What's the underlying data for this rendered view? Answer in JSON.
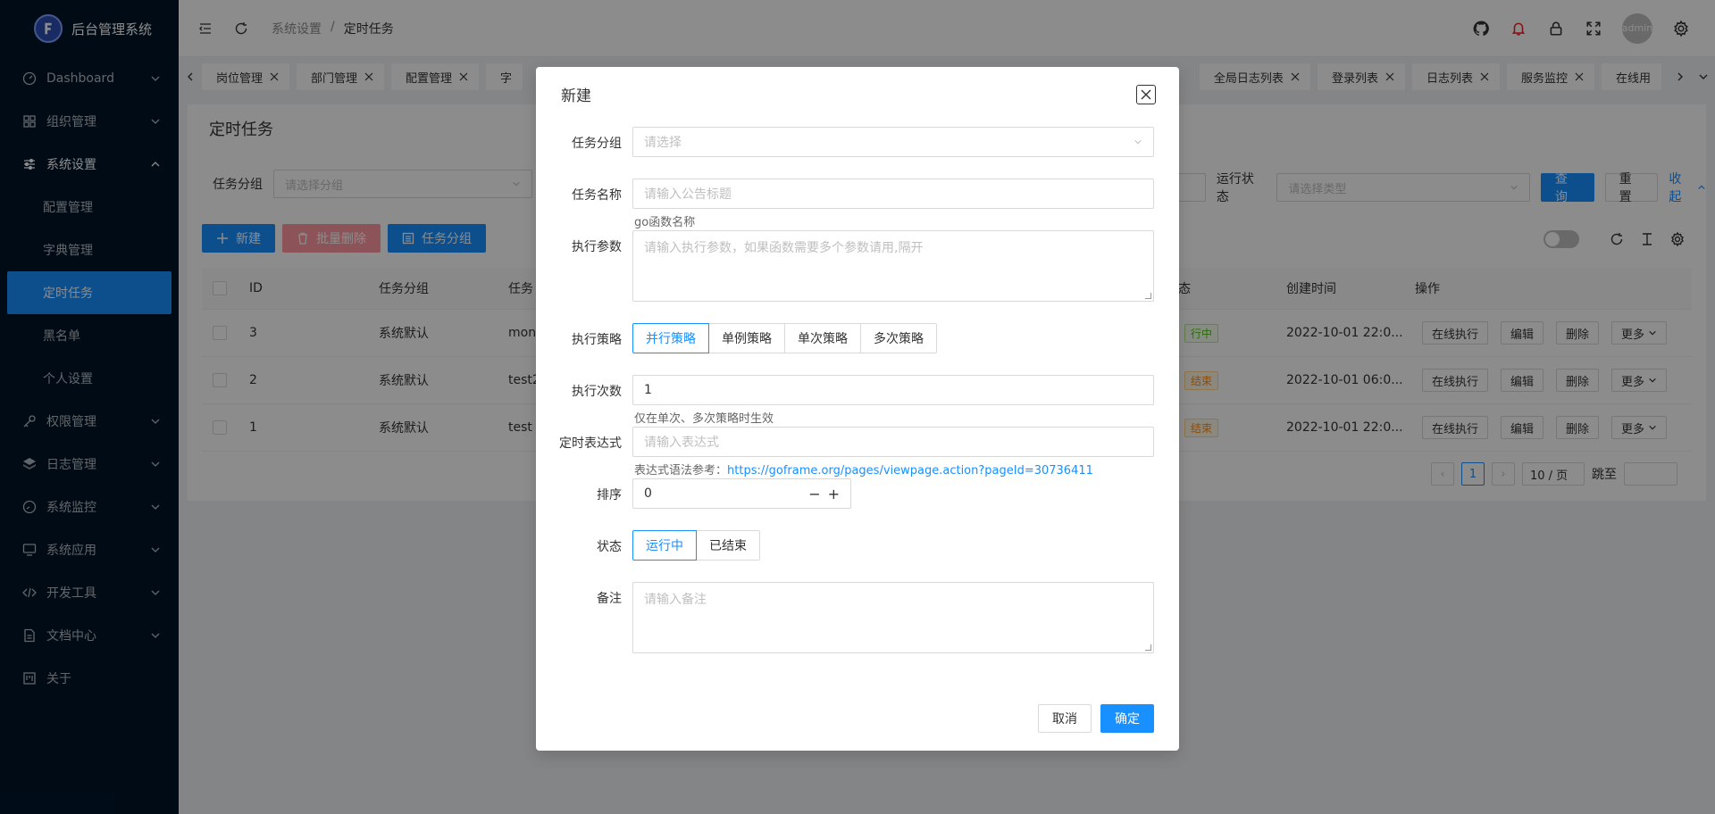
{
  "app": {
    "title": "后台管理系统",
    "avatar_text": "admin"
  },
  "sidebar": {
    "items": [
      {
        "label": "Dashboard",
        "icon": "dashboard-icon"
      },
      {
        "label": "组织管理",
        "icon": "grid-icon"
      },
      {
        "label": "系统设置",
        "icon": "sliders-icon"
      },
      {
        "label": "权限管理",
        "icon": "key-icon"
      },
      {
        "label": "日志管理",
        "icon": "layers-icon"
      },
      {
        "label": "系统监控",
        "icon": "gauge-icon"
      },
      {
        "label": "系统应用",
        "icon": "monitor-icon"
      },
      {
        "label": "开发工具",
        "icon": "code-icon"
      },
      {
        "label": "文档中心",
        "icon": "file-icon"
      },
      {
        "label": "关于",
        "icon": "board-icon"
      }
    ],
    "sub_items": [
      "配置管理",
      "字典管理",
      "定时任务",
      "黑名单",
      "个人设置"
    ]
  },
  "header": {
    "breadcrumb": [
      "系统设置",
      "/",
      "定时任务"
    ]
  },
  "tabs": [
    "岗位管理",
    "部门管理",
    "配置管理",
    "字",
    "全局日志列表",
    "登录列表",
    "日志列表",
    "服务监控",
    "在线用"
  ],
  "page": {
    "title": "定时任务",
    "filter": {
      "group_label": "任务分组",
      "group_placeholder": "请选择分组",
      "status_label": "运行状态",
      "status_placeholder": "请选择类型",
      "query": "查询",
      "reset": "重置",
      "collapse": "收起"
    },
    "toolbar": {
      "new": "新建",
      "batch_delete": "批量删除",
      "group": "任务分组"
    },
    "table": {
      "columns": [
        "ID",
        "任务分组",
        "任务",
        "态",
        "创建时间",
        "操作"
      ],
      "rows": [
        {
          "id": "3",
          "group": "系统默认",
          "name": "moni",
          "status": "行中",
          "created": "2022-10-01 22:0..."
        },
        {
          "id": "2",
          "group": "系统默认",
          "name": "test2",
          "status": "结束",
          "created": "2022-10-01 06:0..."
        },
        {
          "id": "1",
          "group": "系统默认",
          "name": "test",
          "status": "结束",
          "created": "2022-10-01 22:0..."
        }
      ],
      "actions": [
        "在线执行",
        "编辑",
        "删除",
        "更多"
      ]
    },
    "pager": {
      "current": "1",
      "size": "10 / 页",
      "jump": "跳至"
    }
  },
  "modal": {
    "title": "新建",
    "fields": {
      "group": {
        "label": "任务分组",
        "placeholder": "请选择"
      },
      "name": {
        "label": "任务名称",
        "placeholder": "请输入公告标题",
        "hint": "go函数名称"
      },
      "params": {
        "label": "执行参数",
        "placeholder": "请输入执行参数，如果函数需要多个参数请用,隔开"
      },
      "policy": {
        "label": "执行策略",
        "options": [
          "并行策略",
          "单例策略",
          "单次策略",
          "多次策略"
        ],
        "selected": "并行策略"
      },
      "count": {
        "label": "执行次数",
        "value": "1",
        "hint": "仅在单次、多次策略时生效"
      },
      "cron": {
        "label": "定时表达式",
        "placeholder": "请输入表达式",
        "hint_prefix": "表达式语法参考：",
        "hint_link": "https://goframe.org/pages/viewpage.action?pageId=30736411"
      },
      "sort": {
        "label": "排序",
        "value": "0"
      },
      "status": {
        "label": "状态",
        "options": [
          "运行中",
          "已结束"
        ],
        "selected": "运行中"
      },
      "remark": {
        "label": "备注",
        "placeholder": "请输入备注"
      }
    },
    "cancel": "取消",
    "ok": "确定"
  },
  "colors": {
    "primary": "#1890ff",
    "sidebar_bg": "#001529"
  }
}
